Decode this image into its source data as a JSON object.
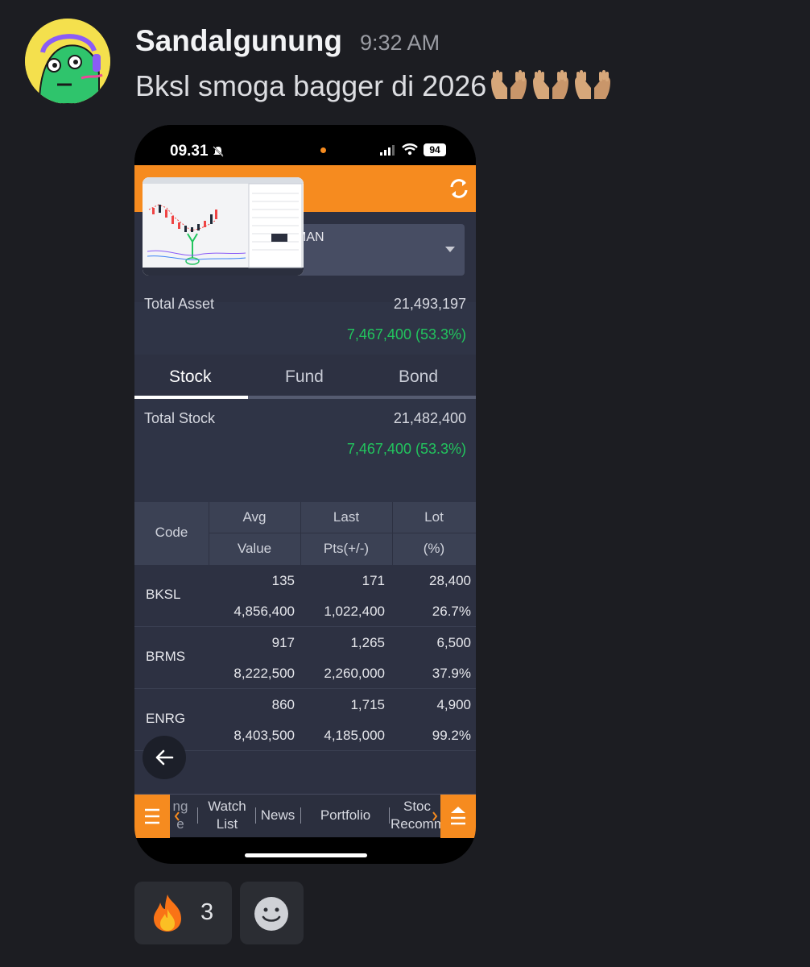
{
  "message": {
    "username": "Sandalgunung",
    "timestamp": "9:32 AM",
    "text": "Bksl smoga bagger di 2026",
    "emoji": [
      "palms-up-together",
      "palms-up-together",
      "palms-up-together"
    ]
  },
  "phone": {
    "status_time": "09.31",
    "battery": "94",
    "account_text": "MAN",
    "total_asset_label": "Total Asset",
    "total_asset_value": "21,493,197",
    "total_asset_gain": "7,467,400 (53.3%)",
    "tabs": [
      "Stock",
      "Fund",
      "Bond"
    ],
    "active_tab": "Stock",
    "total_stock_label": "Total Stock",
    "total_stock_value": "21,482,400",
    "total_stock_gain": "7,467,400 (53.3%)",
    "table_headers": {
      "code": "Code",
      "avg": "Avg",
      "value": "Value",
      "last": "Last",
      "pts": "Pts(+/-)",
      "lot": "Lot",
      "pct": "(%)"
    },
    "rows": [
      {
        "code": "BKSL",
        "avg": "135",
        "last": "171",
        "lot": "28,400",
        "value": "4,856,400",
        "pts": "1,022,400",
        "pct": "26.7%"
      },
      {
        "code": "BRMS",
        "avg": "917",
        "last": "1,265",
        "lot": "6,500",
        "value": "8,222,500",
        "pts": "2,260,000",
        "pct": "37.9%"
      },
      {
        "code": "ENRG",
        "avg": "860",
        "last": "1,715",
        "lot": "4,900",
        "value": "8,403,500",
        "pts": "4,185,000",
        "pct": "99.2%"
      }
    ],
    "bottom_nav": {
      "partial_left_top": "ng",
      "partial_left_bottom": "e",
      "watch_list_1": "Watch",
      "watch_list_2": "List",
      "news": "News",
      "portfolio": "Portfolio",
      "stock_rec_1": "Stoc",
      "stock_rec_2": "Recomm"
    }
  },
  "reactions": [
    {
      "emoji": "fire",
      "count": "3"
    }
  ],
  "colors": {
    "accent": "#f68b1f",
    "gain": "#22c55e",
    "background": "#1c1d22",
    "app_bg": "#2d3142"
  }
}
